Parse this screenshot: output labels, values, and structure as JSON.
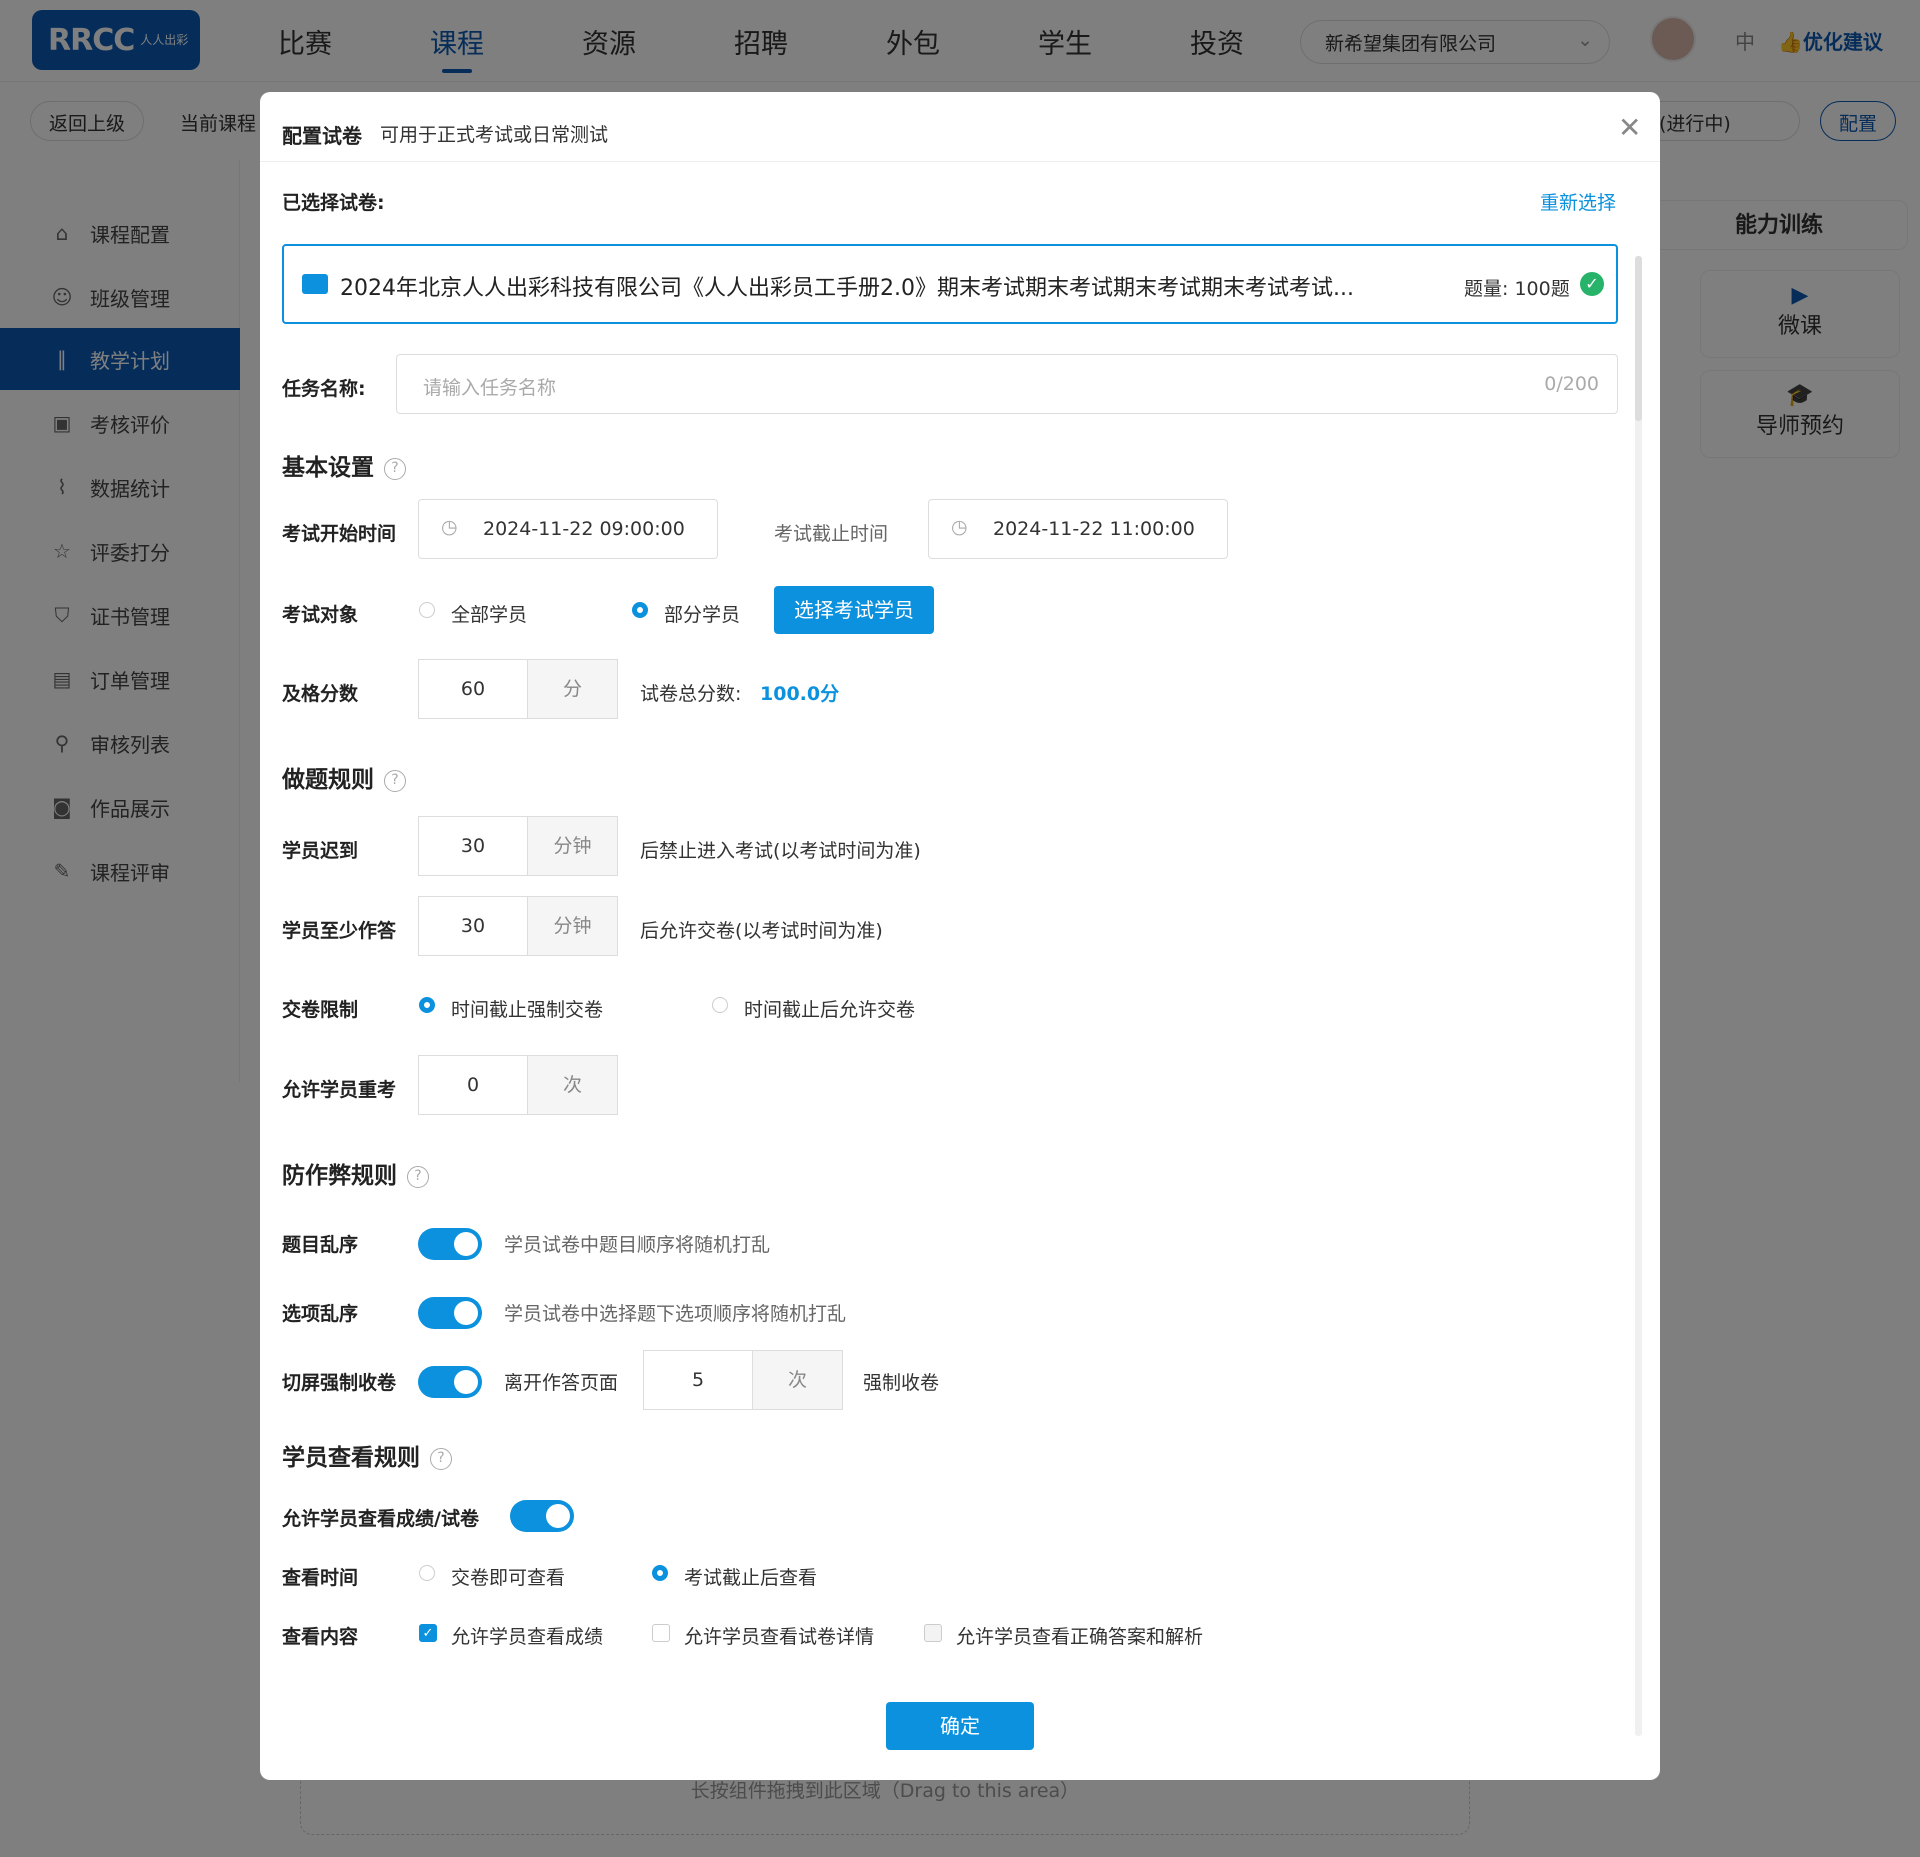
{
  "topbar": {
    "logo_text": "RRCC",
    "logo_sub": "人人出彩",
    "nav": [
      "比赛",
      "课程",
      "资源",
      "招聘",
      "外包",
      "学生",
      "投资"
    ],
    "company": "新希望集团有限公司",
    "lang": "中",
    "suggest": "优化建议"
  },
  "subbar": {
    "back": "返回上级",
    "current": "当前课程",
    "status": "(进行中)",
    "config": "配置"
  },
  "sidebar": {
    "items": [
      {
        "label": "课程配置",
        "icon": "home-icon"
      },
      {
        "label": "班级管理",
        "icon": "user-icon"
      },
      {
        "label": "教学计划",
        "icon": "plan-icon"
      },
      {
        "label": "考核评价",
        "icon": "calendar-check-icon"
      },
      {
        "label": "数据统计",
        "icon": "chart-icon"
      },
      {
        "label": "评委打分",
        "icon": "star-icon"
      },
      {
        "label": "证书管理",
        "icon": "shield-icon"
      },
      {
        "label": "订单管理",
        "icon": "order-icon"
      },
      {
        "label": "审核列表",
        "icon": "stamp-icon"
      },
      {
        "label": "作品展示",
        "icon": "camera-icon"
      },
      {
        "label": "课程评审",
        "icon": "review-icon"
      }
    ],
    "active_index": 2
  },
  "right_panel": {
    "title": "能力训练",
    "cards": [
      "微课",
      "导师预约"
    ]
  },
  "dropzone_text": "长按组件拖拽到此区域（Drag to this area）",
  "modal": {
    "title": "配置试卷",
    "subtitle": "可用于正式考试或日常测试",
    "selected_label": "已选择试卷:",
    "reselect": "重新选择",
    "paper_title": "2024年北京人人出彩科技有限公司《人人出彩员工手册2.0》期末考试期末考试期末考试期末考试考试...",
    "paper_count": "题量: 100题",
    "task_label": "任务名称:",
    "task_placeholder": "请输入任务名称",
    "task_counter": "0/200",
    "basic": {
      "title": "基本设置",
      "start_label": "考试开始时间",
      "start_value": "2024-11-22  09:00:00",
      "end_label": "考试截止时间",
      "end_value": "2024-11-22  11:00:00",
      "target_label": "考试对象",
      "target_all": "全部学员",
      "target_part": "部分学员",
      "select_btn": "选择考试学员",
      "pass_label": "及格分数",
      "pass_value": "60",
      "pass_unit": "分",
      "total_label": "试卷总分数:",
      "total_value": "100.0分"
    },
    "rules": {
      "title": "做题规则",
      "late_label": "学员迟到",
      "late_value": "30",
      "late_unit": "分钟",
      "late_desc": "后禁止进入考试(以考试时间为准)",
      "min_label": "学员至少作答",
      "min_value": "30",
      "min_unit": "分钟",
      "min_desc": "后允许交卷(以考试时间为准)",
      "submit_label": "交卷限制",
      "submit_opt1": "时间截止强制交卷",
      "submit_opt2": "时间截止后允许交卷",
      "retake_label": "允许学员重考",
      "retake_value": "0",
      "retake_unit": "次"
    },
    "anti": {
      "title": "防作弊规则",
      "shuffle_q_label": "题目乱序",
      "shuffle_q_desc": "学员试卷中题目顺序将随机打乱",
      "shuffle_o_label": "选项乱序",
      "shuffle_o_desc": "学员试卷中选择题下选项顺序将随机打乱",
      "switch_label": "切屏强制收卷",
      "switch_prefix": "离开作答页面",
      "switch_value": "5",
      "switch_unit": "次",
      "switch_suffix": "强制收卷"
    },
    "view": {
      "title": "学员查看规则",
      "allow_label": "允许学员查看成绩/试卷",
      "time_label": "查看时间",
      "time_opt1": "交卷即可查看",
      "time_opt2": "考试截止后查看",
      "content_label": "查看内容",
      "content_opt1": "允许学员查看成绩",
      "content_opt2": "允许学员查看试卷详情",
      "content_opt3": "允许学员查看正确答案和解析"
    },
    "confirm": "确定"
  },
  "colors": {
    "brand": "#0d5bb5",
    "accent": "#0b91dd",
    "success": "#27b36a"
  }
}
